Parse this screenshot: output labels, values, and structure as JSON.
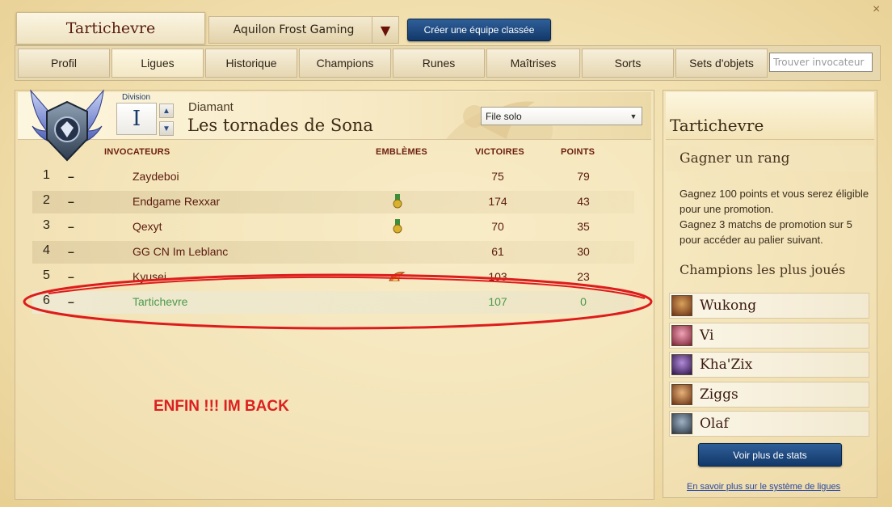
{
  "header": {
    "summoner_name": "Tartichevre",
    "team": "Aquilon Frost Gaming",
    "create_team_label": "Créer une équipe classée"
  },
  "nav": {
    "tabs": [
      "Profil",
      "Ligues",
      "Historique",
      "Champions",
      "Runes",
      "Maîtrises",
      "Sorts",
      "Sets d'objets"
    ],
    "active": "Ligues",
    "search_placeholder": "Trouver invocateur"
  },
  "league": {
    "division_label": "Division",
    "division": "I",
    "tier": "Diamant",
    "name": "Les tornades de Sona",
    "queue": "File solo",
    "columns": {
      "summoners": "INVOCATEURS",
      "emblems": "EMBLÈMES",
      "wins": "VICTOIRES",
      "points": "POINTS"
    },
    "rows": [
      {
        "rank": "1",
        "trend": "–",
        "name": "Zaydeboi",
        "emblem": "",
        "wins": "75",
        "points": "79"
      },
      {
        "rank": "2",
        "trend": "–",
        "name": "Endgame Rexxar",
        "emblem": "medal-icon",
        "wins": "174",
        "points": "43"
      },
      {
        "rank": "3",
        "trend": "–",
        "name": "Qexyt",
        "emblem": "medal-icon",
        "wins": "70",
        "points": "35"
      },
      {
        "rank": "4",
        "trend": "–",
        "name": "GG CN Im Leblanc",
        "emblem": "",
        "wins": "61",
        "points": "30"
      },
      {
        "rank": "5",
        "trend": "–",
        "name": "Kyusei",
        "emblem": "hot-streak-icon",
        "wins": "103",
        "points": "23"
      },
      {
        "rank": "6",
        "trend": "–",
        "name": "Tartichevre",
        "emblem": "",
        "wins": "107",
        "points": "0"
      }
    ]
  },
  "annotation": "ENFIN !!! IM BACK",
  "annotation_color": "#dc2020",
  "side": {
    "title": "Tartichevre",
    "rank_title": "Gagner un rang",
    "rank_desc_1": "Gagnez 100 points et vous serez éligible pour une promotion.",
    "rank_desc_2": "Gagnez 3 matchs de promotion sur 5 pour accéder au palier suivant.",
    "champions_title": "Champions les plus joués",
    "champions": [
      {
        "name": "Wukong",
        "color": "#8a4a2a"
      },
      {
        "name": "Vi",
        "color": "#b0405a"
      },
      {
        "name": "Kha'Zix",
        "color": "#5a2f7a"
      },
      {
        "name": "Ziggs",
        "color": "#9a5a2a"
      },
      {
        "name": "Olaf",
        "color": "#4a5a6a"
      }
    ],
    "more_stats_label": "Voir plus de stats",
    "learn_more_link": "En savoir plus sur le système de ligues"
  },
  "colors": {
    "accent_blue": "#123869",
    "header_red": "#6b1e0e",
    "self_green": "#4b9a4b"
  }
}
